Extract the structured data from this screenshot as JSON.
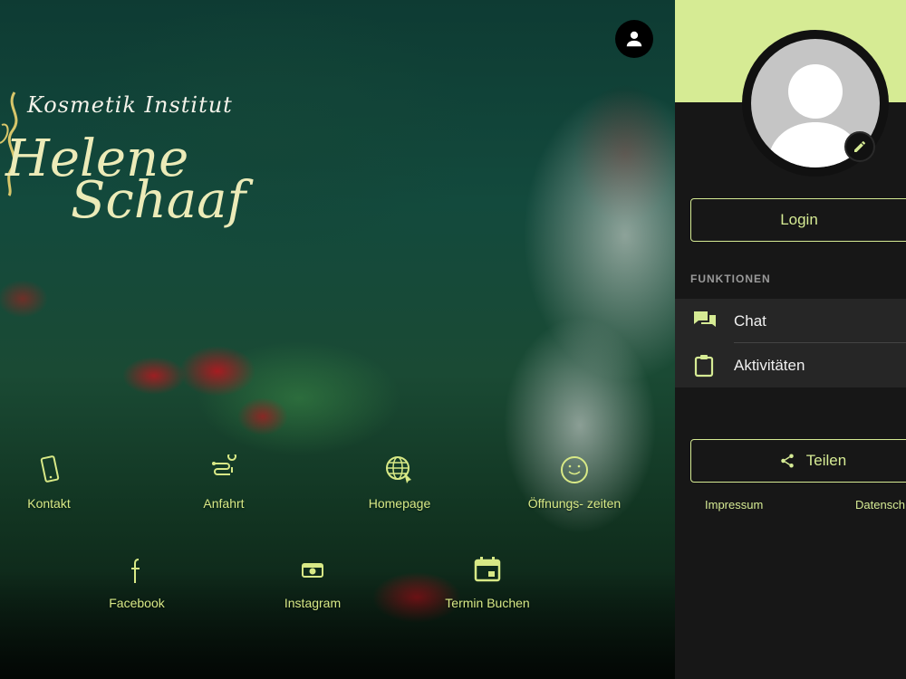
{
  "hero": {
    "logo": {
      "subtitle": "Kosmetik Institut",
      "line1": "Helene",
      "line2": "Schaaf"
    },
    "tiles": [
      {
        "label": "Kontakt",
        "icon": "phone-icon"
      },
      {
        "label": "Anfahrt",
        "icon": "route-icon"
      },
      {
        "label": "Homepage",
        "icon": "web-icon"
      },
      {
        "label": "Öffnungs- zeiten",
        "icon": "clock-icon"
      },
      {
        "label": "Facebook",
        "icon": "facebook-icon"
      },
      {
        "label": "Instagram",
        "icon": "camera-icon"
      },
      {
        "label": "Termin Buchen",
        "icon": "calendar-icon"
      }
    ]
  },
  "panel": {
    "login_label": "Login",
    "funktionen_header": "FUNKTIONEN",
    "menu": [
      {
        "label": "Chat",
        "icon": "chat-icon"
      },
      {
        "label": "Aktivitäten",
        "icon": "clipboard-icon"
      }
    ],
    "share_label": "Teilen",
    "footer": {
      "impressum": "Impressum",
      "datenschutz": "Datensch"
    }
  },
  "colors": {
    "accent": "#d6eb94",
    "panel_bg": "#171717",
    "menu_bg": "#262626",
    "tile_text": "#d8e986"
  }
}
